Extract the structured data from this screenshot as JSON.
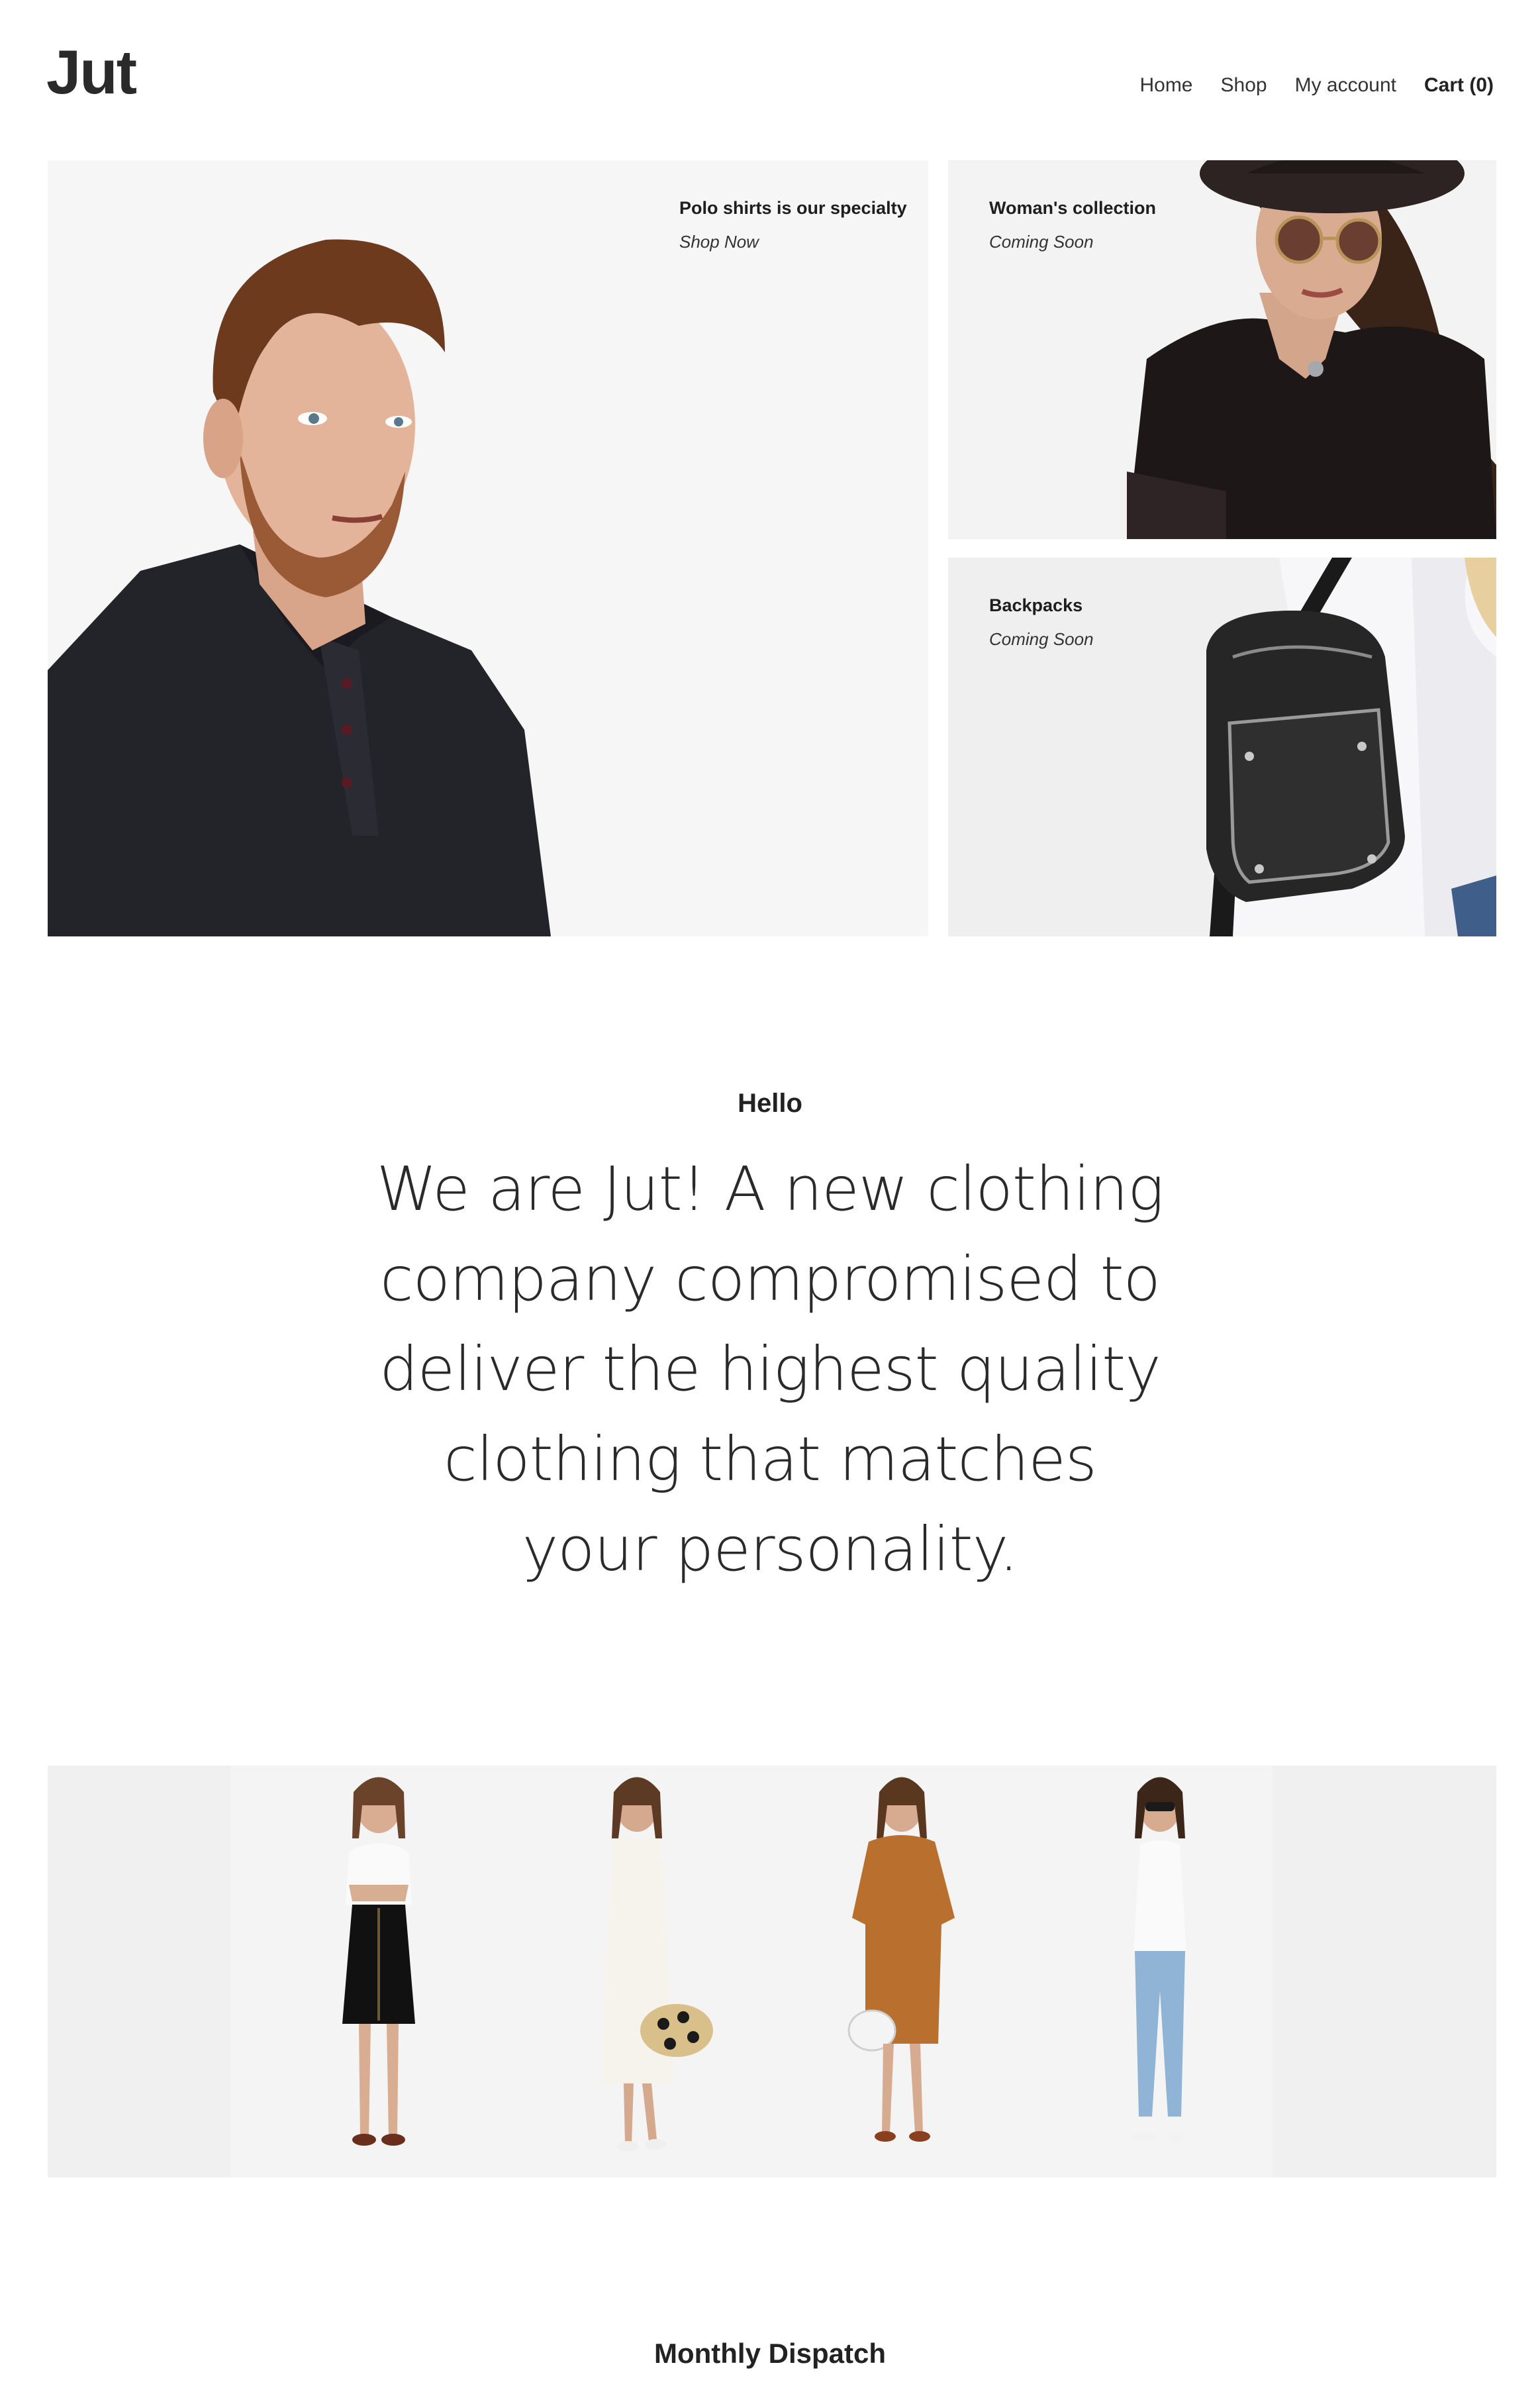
{
  "header": {
    "logo": "Jut",
    "nav": {
      "home": "Home",
      "shop": "Shop",
      "account": "My account",
      "cart": "Cart (0)"
    }
  },
  "hero": {
    "main": {
      "title": "Polo shirts is our specialty",
      "link": "Shop Now"
    },
    "woman": {
      "title": "Woman's collection",
      "link": "Coming Soon"
    },
    "backpacks": {
      "title": "Backpacks",
      "link": "Coming Soon"
    }
  },
  "intro": {
    "greeting": "Hello",
    "text": "We are Jut! A new clothing company compromised to deliver the highest quality clothing that matches your personality."
  },
  "newsletter": {
    "title": "Monthly Dispatch"
  },
  "colors": {
    "text": "#222222",
    "tile_bg": "#f6f6f6",
    "strip_bg": "#f0f0f0"
  }
}
